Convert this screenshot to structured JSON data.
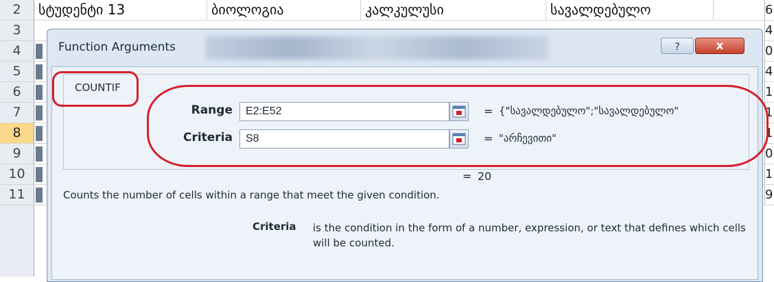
{
  "sheet": {
    "header_row": {
      "num": "2",
      "c1": "სტუდენტი 13",
      "c2": "ბიოლოგია",
      "c3": "კალკულუსი",
      "c4": "სავალდებულო",
      "edge": "6"
    },
    "rows": [
      {
        "num": "3",
        "edge": "4"
      },
      {
        "num": "4",
        "edge": "0"
      },
      {
        "num": "5",
        "edge": "4"
      },
      {
        "num": "6",
        "edge": "1"
      },
      {
        "num": "7",
        "edge": "1"
      },
      {
        "num": "8",
        "edge": "1"
      },
      {
        "num": "9",
        "edge": "0"
      },
      {
        "num": "10",
        "edge": "1"
      },
      {
        "num": "11",
        "edge": "9"
      }
    ],
    "active_row": "8"
  },
  "dialog": {
    "title": "Function Arguments",
    "help_label": "?",
    "close_label": "x",
    "function_name": "COUNTIF",
    "args": [
      {
        "label": "Range",
        "value": "E2:E52",
        "result": "{\"სავალდებულო\";\"სავალდებულო\""
      },
      {
        "label": "Criteria",
        "value": "S8",
        "result": "\"არჩევითი\""
      }
    ],
    "eq_sign": "=",
    "result_text": "20",
    "description": "Counts the number of cells within a range that meet the given condition.",
    "arg_help_label": "Criteria",
    "arg_help_text": "is the condition in the form of a number, expression, or text that defines which cells will be counted."
  },
  "colors": {
    "highlight": "#d4202a",
    "active_row": "#f9d88a"
  }
}
